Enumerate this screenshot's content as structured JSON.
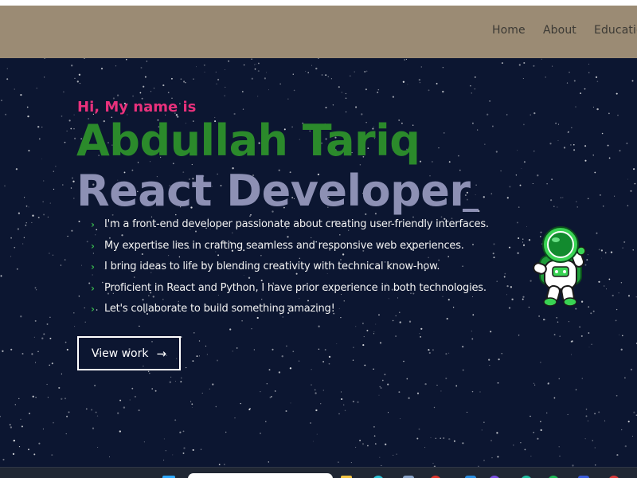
{
  "nav": {
    "links": [
      {
        "label": "Home"
      },
      {
        "label": "About"
      },
      {
        "label": "Educatio"
      }
    ]
  },
  "hero": {
    "greeting": "Hi, My name is",
    "name": "Abdullah Tariq",
    "role": "React Developer",
    "bullets": [
      "I'm a front-end developer passionate about creating user-friendly interfaces.",
      "My expertise lies in crafting seamless and responsive web experiences.",
      "I bring ideas to life by blending creativity with technical know-how.",
      "Proficient in React and Python, I have prior experience in both technologies.",
      "Let's collaborate to build something amazing!"
    ],
    "button_label": "View work",
    "button_icon": "arrow-right-icon"
  },
  "colors": {
    "navbar_bg": "#9b8b74",
    "hero_bg": "#0c1631",
    "greeting": "#e8317c",
    "name": "#2b8a2b",
    "role": "#8d90b4",
    "chevron": "#37b24d"
  }
}
